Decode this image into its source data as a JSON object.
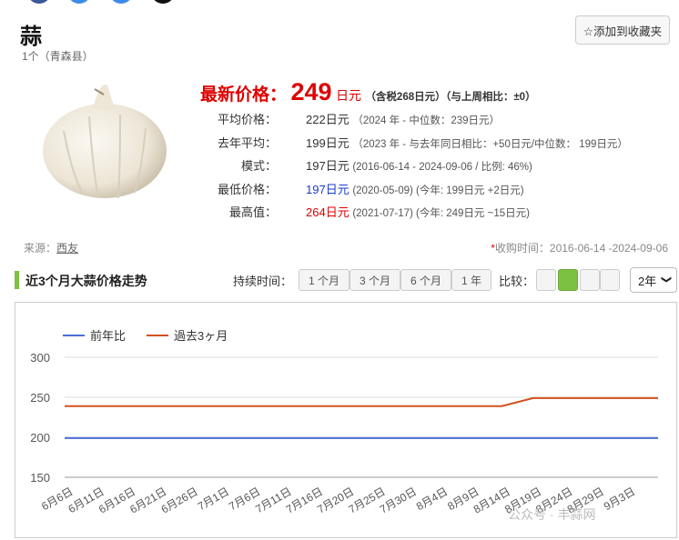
{
  "product": {
    "title": "蒜",
    "subtitle": "1个（青森县）",
    "favorite_label": "☆添加到收藏夹"
  },
  "price": {
    "latest_label": "最新价格：",
    "latest_value": "249",
    "latest_unit": "日元",
    "latest_note": "（含税268日元）（与上周相比：±0）"
  },
  "stats": [
    {
      "label": "平均价格：",
      "value": "222日元",
      "extra": "（2024 年 - 中位数：239日元）"
    },
    {
      "label": "去年平均：",
      "value": "199日元",
      "extra_a": "（2023 年 - 与去年同日相比：",
      "extra_red": "+50日元",
      "extra_b": "/中位数： 199日元）"
    },
    {
      "label": "模式：",
      "value": "197日元",
      "extra": "(2016-06-14 - 2024-09-06 / 比例: 46%)"
    },
    {
      "label": "最低价格：",
      "value": "197日元",
      "extra_a": "(2020-05-09) (今年: 199日元 ",
      "extra_red": "+2日元",
      "extra_b": ")"
    },
    {
      "label": "最高值：",
      "value": "264日元",
      "extra_a": "(2021-07-17) (今年: 249日元 ",
      "extra_blue": "~15日元",
      "extra_b": ")"
    }
  ],
  "source": {
    "label": "来源：",
    "name": "西友"
  },
  "collection_period": {
    "star": "*",
    "text": "收购时间：2016-06-14 -2024-09-06"
  },
  "section": {
    "title": "近3个月大蒜价格走势",
    "duration_label": "持续时间：",
    "durations": [
      "1 个月",
      "3 个月",
      "6 个月",
      "1 年"
    ],
    "compare_label": "比较：",
    "year_select": "2年"
  },
  "watermark": "公众号 · 丰蒜网",
  "colors": {
    "accent_green": "#7dc142",
    "price_red": "#dd0000",
    "series_blue": "#4a6fd6",
    "series_orange": "#d4501e"
  },
  "chart_data": {
    "type": "line",
    "x": [
      "6月6日",
      "6月11日",
      "6月16日",
      "6月21日",
      "6月26日",
      "7月1日",
      "7月6日",
      "7月11日",
      "7月16日",
      "7月20日",
      "7月25日",
      "7月30日",
      "8月4日",
      "8月9日",
      "8月14日",
      "8月19日",
      "8月24日",
      "8月29日",
      "9月3日"
    ],
    "series": [
      {
        "name": "前年比",
        "color": "#4a6fd6",
        "values": [
          199,
          199,
          199,
          199,
          199,
          199,
          199,
          199,
          199,
          199,
          199,
          199,
          199,
          199,
          199,
          199,
          199,
          199,
          199,
          199
        ]
      },
      {
        "name": "過去3ヶ月",
        "color": "#d4501e",
        "values": [
          239,
          239,
          239,
          239,
          239,
          239,
          239,
          239,
          239,
          239,
          239,
          239,
          239,
          239,
          239,
          249,
          249,
          249,
          249,
          249
        ]
      }
    ],
    "yticks": [
      150,
      200,
      250,
      300
    ],
    "ylim": [
      150,
      300
    ],
    "grid": true,
    "legend": "top-left"
  }
}
